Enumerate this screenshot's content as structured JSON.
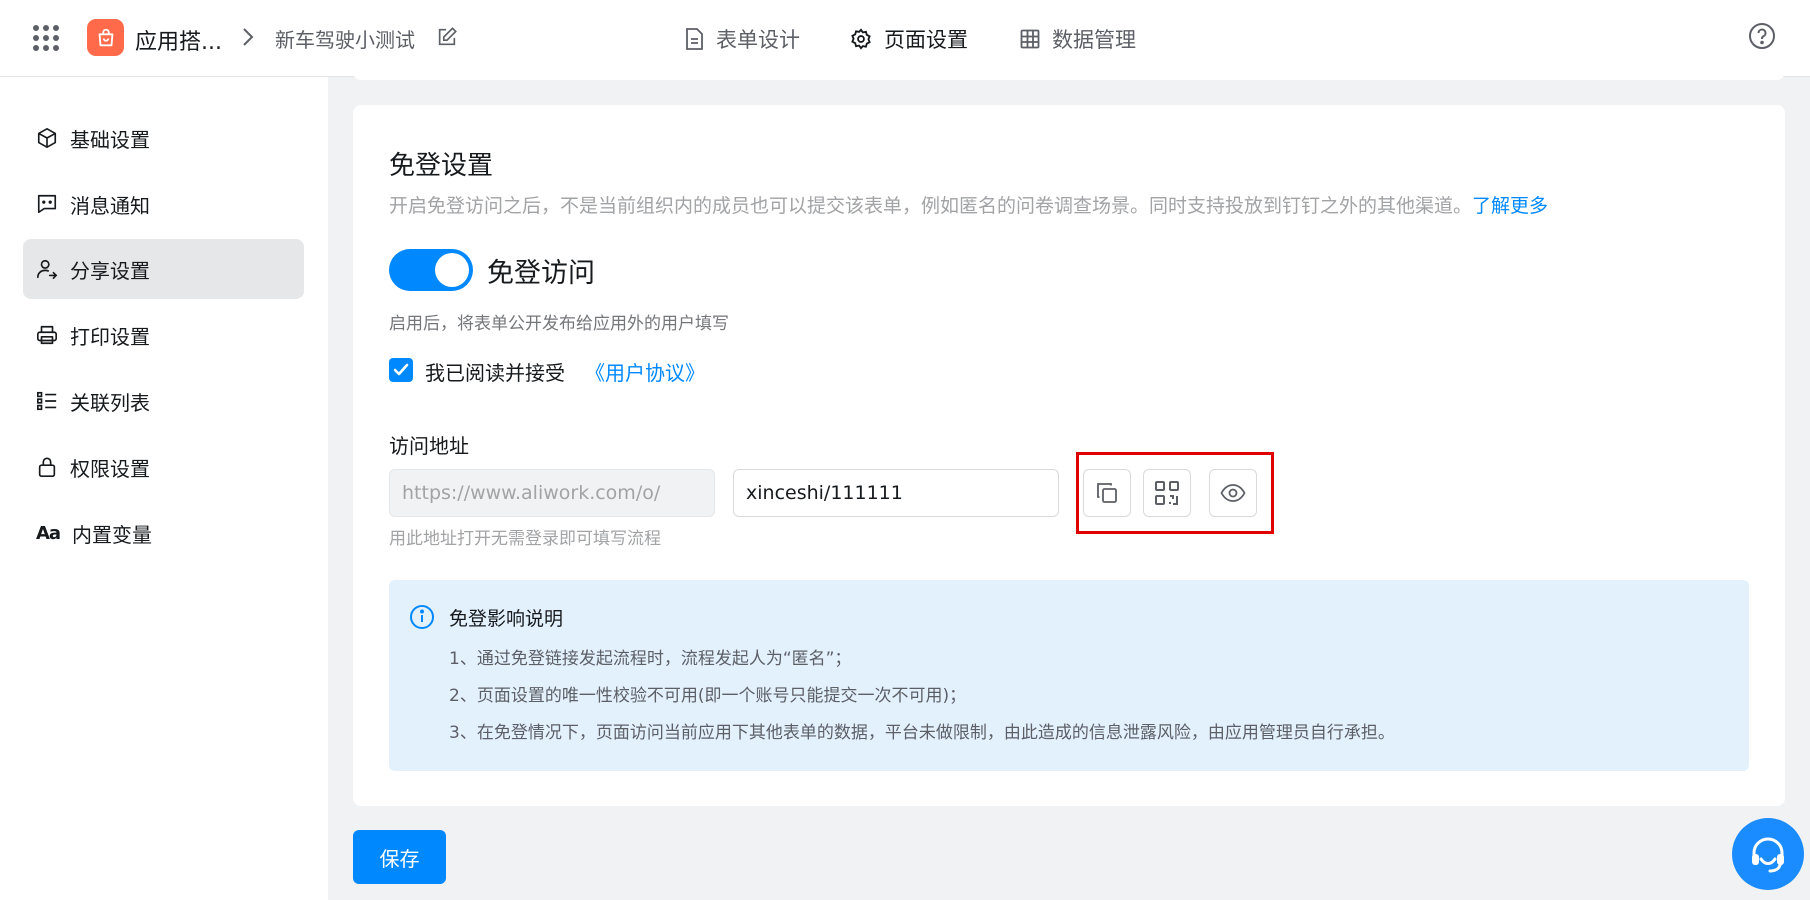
{
  "header": {
    "app_name": "应用搭...",
    "form_name": "新车驾驶小测试",
    "tabs": [
      {
        "label": "表单设计"
      },
      {
        "label": "页面设置"
      },
      {
        "label": "数据管理"
      }
    ],
    "active_tab": "页面设置"
  },
  "sidebar": {
    "items": [
      {
        "label": "基础设置",
        "icon": "cube-icon"
      },
      {
        "label": "消息通知",
        "icon": "message-icon"
      },
      {
        "label": "分享设置",
        "icon": "share-user-icon"
      },
      {
        "label": "打印设置",
        "icon": "printer-icon"
      },
      {
        "label": "关联列表",
        "icon": "list-icon"
      },
      {
        "label": "权限设置",
        "icon": "lock-icon"
      },
      {
        "label": "内置变量",
        "icon": "text-aa-icon",
        "glyph": "Aa"
      }
    ],
    "active_item": "分享设置"
  },
  "login_free": {
    "title": "免登设置",
    "description": "开启免登访问之后，不是当前组织内的成员也可以提交该表单，例如匿名的问卷调查场景。同时支持投放到钉钉之外的其他渠道。",
    "learn_more": "了解更多",
    "toggle_label": "免登访问",
    "toggle_on": true,
    "toggle_hint": "启用后，将表单公开发布给应用外的用户填写",
    "agree_checked": true,
    "agree_text": "我已阅读并接受",
    "agree_link": "《用户协议》",
    "address_label": "访问地址",
    "address_prefix": "https://www.aliwork.com/o/",
    "address_suffix": "xinceshi/111111",
    "address_hint": "用此地址打开无需登录即可填写流程"
  },
  "info_box": {
    "title": "免登影响说明",
    "lines": [
      "1、通过免登链接发起流程时，流程发起人为“匿名”；",
      "2、页面设置的唯一性校验不可用(即一个账号只能提交一次不可用)；",
      "3、在免登情况下，页面访问当前应用下其他表单的数据，平台未做限制，由此造成的信息泄露风险，由应用管理员自行承担。"
    ]
  },
  "actions": {
    "save_label": "保存"
  },
  "colors": {
    "primary": "#0089ff",
    "app_logo": "#ff6b4a",
    "highlight": "#e00000",
    "info_bg": "#e3f1fd"
  }
}
